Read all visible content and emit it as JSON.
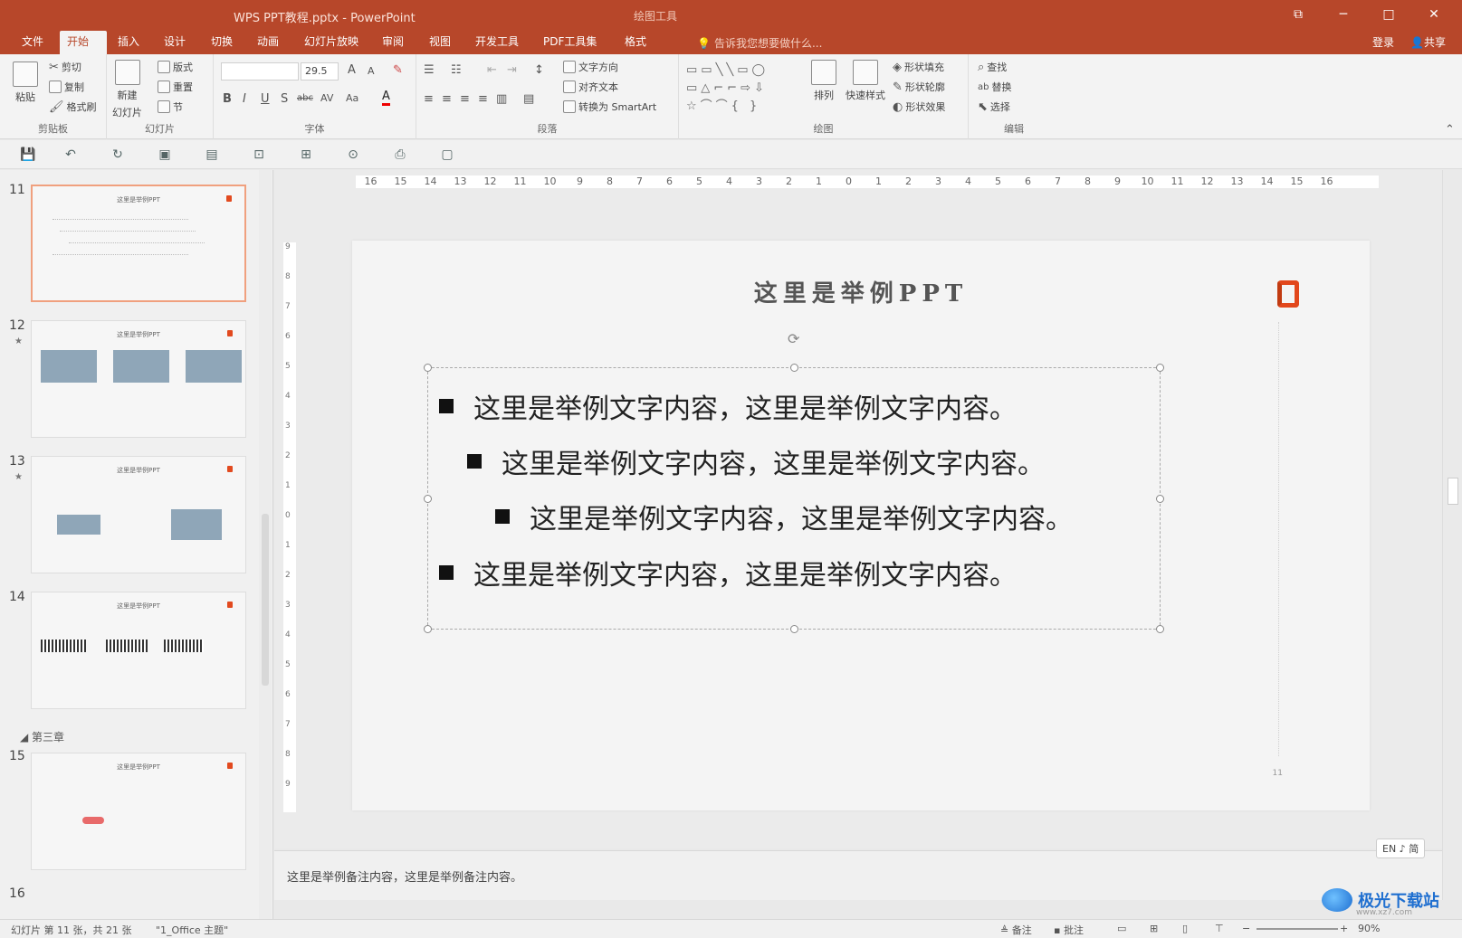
{
  "window": {
    "title": "WPS PPT教程.pptx - PowerPoint",
    "context_tab_group": "绘图工具",
    "controls": [
      "⧉",
      "─",
      "□",
      "✕"
    ]
  },
  "tabs": [
    {
      "label": "文件"
    },
    {
      "label": "开始",
      "active": true
    },
    {
      "label": "插入"
    },
    {
      "label": "设计"
    },
    {
      "label": "切换"
    },
    {
      "label": "动画"
    },
    {
      "label": "幻灯片放映"
    },
    {
      "label": "审阅"
    },
    {
      "label": "视图"
    },
    {
      "label": "开发工具"
    },
    {
      "label": "PDF工具集"
    },
    {
      "label": "格式"
    }
  ],
  "tell_me": "告诉我您想要做什么...",
  "account": {
    "login": "登录",
    "share": "共享"
  },
  "ribbon": {
    "clipboard": {
      "paste": "粘贴",
      "cut": "剪切",
      "copy": "复制",
      "format_painter": "格式刷",
      "label": "剪贴板"
    },
    "slides": {
      "new_slide": "新建",
      "new_slide_2": "幻灯片",
      "layout": "版式",
      "reset": "重置",
      "section": "节",
      "label": "幻灯片"
    },
    "font": {
      "font_size": "29.5",
      "label": "字体",
      "bold": "B",
      "italic": "I",
      "underline": "U",
      "shadow": "S",
      "strike": "abc",
      "spacing": "AV",
      "case": "Aa",
      "grow": "A",
      "shrink": "A",
      "color": "A"
    },
    "paragraph": {
      "text_direction": "文字方向",
      "align_text": "对齐文本",
      "smartart": "转换为 SmartArt",
      "label": "段落"
    },
    "drawing": {
      "arrange": "排列",
      "quick_styles": "快速样式",
      "shape_fill": "形状填充",
      "shape_outline": "形状轮廓",
      "shape_effects": "形状效果",
      "label": "绘图"
    },
    "editing": {
      "find": "查找",
      "replace": "替换",
      "select": "选择",
      "label": "编辑"
    }
  },
  "ruler": {
    "h_ticks": [
      "16",
      "15",
      "14",
      "13",
      "12",
      "11",
      "10",
      "9",
      "8",
      "7",
      "6",
      "5",
      "4",
      "3",
      "2",
      "1",
      "0",
      "1",
      "2",
      "3",
      "4",
      "5",
      "6",
      "7",
      "8",
      "9",
      "10",
      "11",
      "12",
      "13",
      "14",
      "15",
      "16"
    ],
    "v_ticks": [
      "9",
      "8",
      "7",
      "6",
      "5",
      "4",
      "3",
      "2",
      "1",
      "0",
      "1",
      "2",
      "3",
      "4",
      "5",
      "6",
      "7",
      "8",
      "9"
    ]
  },
  "thumbnails": [
    {
      "num": "11",
      "title": "这里是举例PPT",
      "selected": true,
      "star": false
    },
    {
      "num": "12",
      "title": "这里是举例PPT",
      "selected": false,
      "star": true
    },
    {
      "num": "13",
      "title": "这里是举例PPT",
      "selected": false,
      "star": true
    },
    {
      "num": "14",
      "title": "这里是举例PPT",
      "selected": false,
      "star": false
    },
    {
      "num": "15",
      "title": "这里是举例PPT",
      "selected": false,
      "star": false
    }
  ],
  "section_label": "第三章",
  "next_thumb_num": "16",
  "slide": {
    "title": "这里是举例PPT",
    "number": "11",
    "bullets": [
      {
        "level": 1,
        "text": "这里是举例文字内容，这里是举例文字内容。"
      },
      {
        "level": 2,
        "text": "这里是举例文字内容，这里是举例文字内容。"
      },
      {
        "level": 3,
        "text": "这里是举例文字内容，这里是举例文字内容。"
      },
      {
        "level": 1,
        "text": "这里是举例文字内容，这里是举例文字内容。"
      }
    ]
  },
  "notes": {
    "text": "这里是举例备注内容，这里是举例备注内容。",
    "ime": "EN ♪ 简"
  },
  "status": {
    "slide_info": "幻灯片 第 11 张，共 21 张",
    "theme": "\"1_Office 主题\"",
    "notes_btn": "备注",
    "comments_btn": "批注",
    "zoom": "90%"
  },
  "watermark": {
    "text": "极光下载站",
    "url": "www.xz7.com"
  },
  "colors": {
    "accent": "#b7472a",
    "office_logo": "#e2471c"
  }
}
